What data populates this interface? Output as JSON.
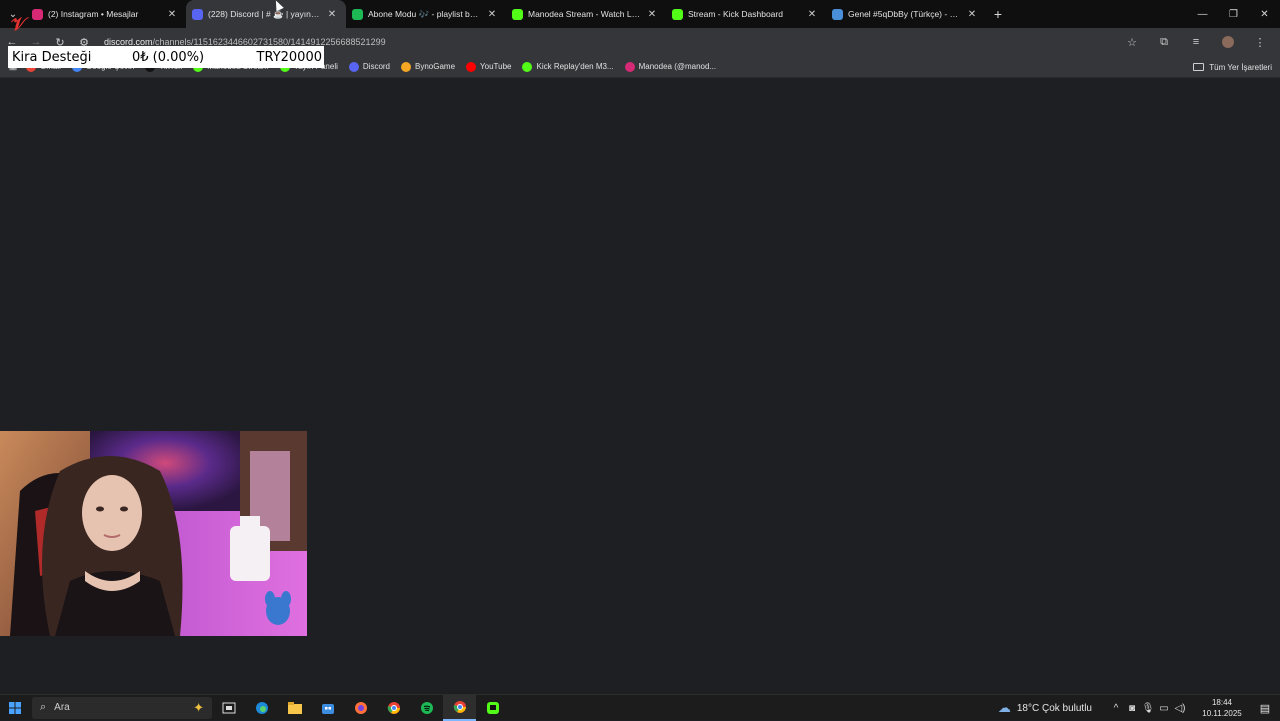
{
  "browser": {
    "tabs": [
      {
        "label": "(2) Instagram • Mesajlar",
        "favicon_color": "#d62976",
        "active": false
      },
      {
        "label": "(228) Discord | # ☕ | yayın-duyu…",
        "favicon_color": "#5865f2",
        "active": true
      },
      {
        "label": "Abone Modu 🎶 - playlist by 2…",
        "favicon_color": "#1db954",
        "active": false
      },
      {
        "label": "Manodea Stream - Watch Live o…",
        "favicon_color": "#53fc18",
        "active": false
      },
      {
        "label": "Stream - Kick Dashboard",
        "favicon_color": "#53fc18",
        "active": false
      },
      {
        "label": "Genel #5qDbBy (Türkçe) - Gart…",
        "favicon_color": "#4a90d9",
        "active": false
      }
    ],
    "url_domain": "discord.com",
    "url_path": "/channels/1151623446602731580/1414912256688521299"
  },
  "bookmarks": {
    "items": [
      {
        "label": "Gmail",
        "color": "#ea4335"
      },
      {
        "label": "Google Çeviri",
        "color": "#4285f4"
      },
      {
        "label": "TikTok",
        "color": "#111111"
      },
      {
        "label": "Manodea Stream",
        "color": "#53fc18"
      },
      {
        "label": "Yayın Paneli",
        "color": "#53fc18"
      },
      {
        "label": "Discord",
        "color": "#5865f2"
      },
      {
        "label": "BynoGame",
        "color": "#f5a623"
      },
      {
        "label": "YouTube",
        "color": "#ff0000"
      },
      {
        "label": "Kick Replay'den M3...",
        "color": "#53fc18"
      },
      {
        "label": "Manodea (@manod...",
        "color": "#d62976"
      }
    ],
    "all_bookmarks": "Tüm Yer İşaretleri"
  },
  "donation_widget": {
    "title": "Kira Desteği",
    "amount": "0₺ (0.00%)",
    "goal": "TRY20000"
  },
  "taskbar": {
    "search_placeholder": "Ara",
    "weather": "18°C  Çok bulutlu",
    "time": "18:44",
    "date": "10.11.2025"
  }
}
